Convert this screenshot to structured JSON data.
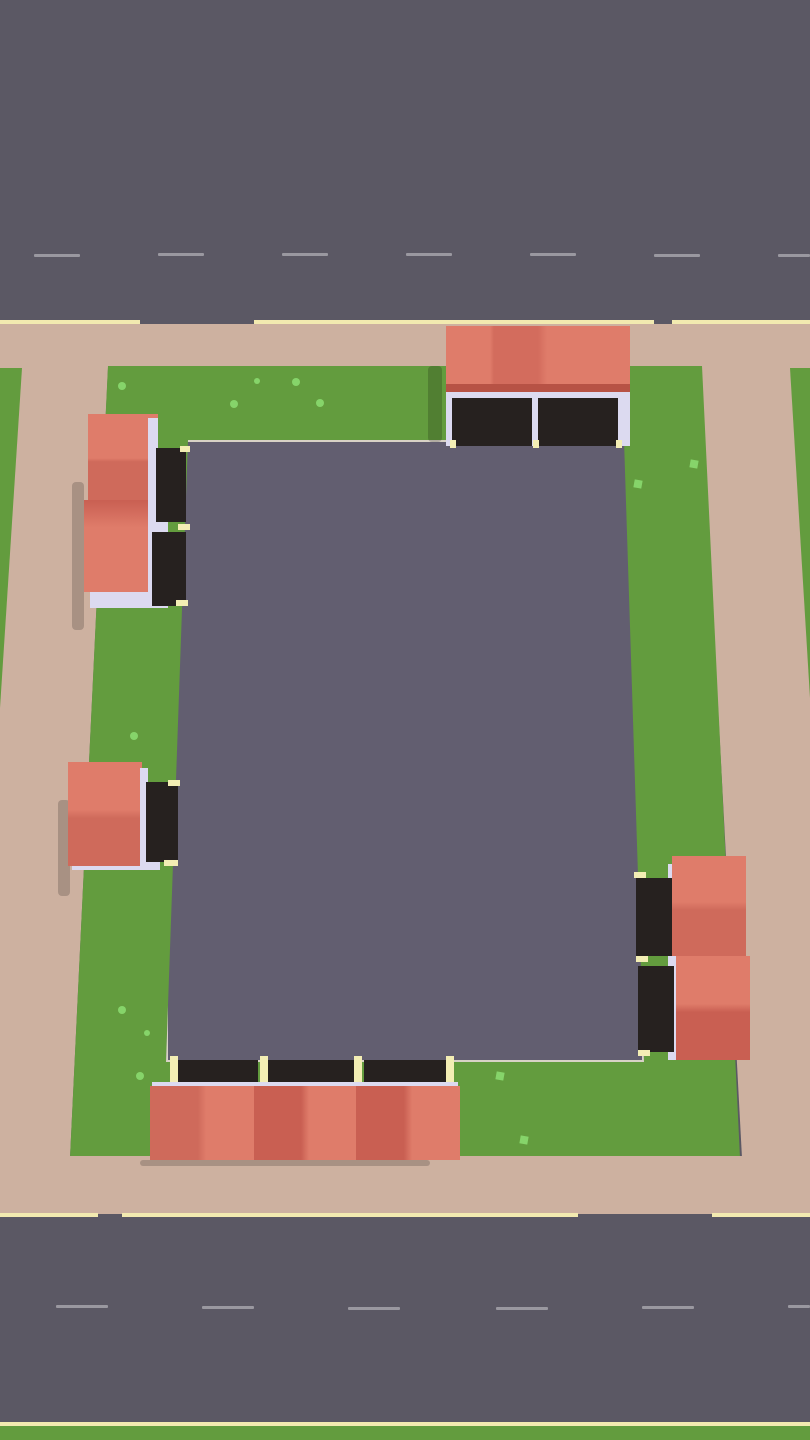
{
  "scene": {
    "name": "parking-lot-top-down-game",
    "colors": {
      "asphalt": "#5b5864",
      "lot_surface": "#625e70",
      "sidewalk": "#cdb1a0",
      "grass": "#639c3e",
      "roof_light": "#df7c6a",
      "roof_dark": "#c45f52",
      "garage_door": "#26211f",
      "road_edge_line": "#f2eab0"
    },
    "garage_groups": [
      {
        "id": "top",
        "count": 2,
        "orientation": "facing-down"
      },
      {
        "id": "left-upper",
        "count": 2,
        "orientation": "facing-right"
      },
      {
        "id": "left-middle",
        "count": 1,
        "orientation": "facing-right"
      },
      {
        "id": "right-lower",
        "count": 2,
        "orientation": "facing-left"
      },
      {
        "id": "bottom",
        "count": 3,
        "orientation": "facing-up"
      }
    ]
  }
}
